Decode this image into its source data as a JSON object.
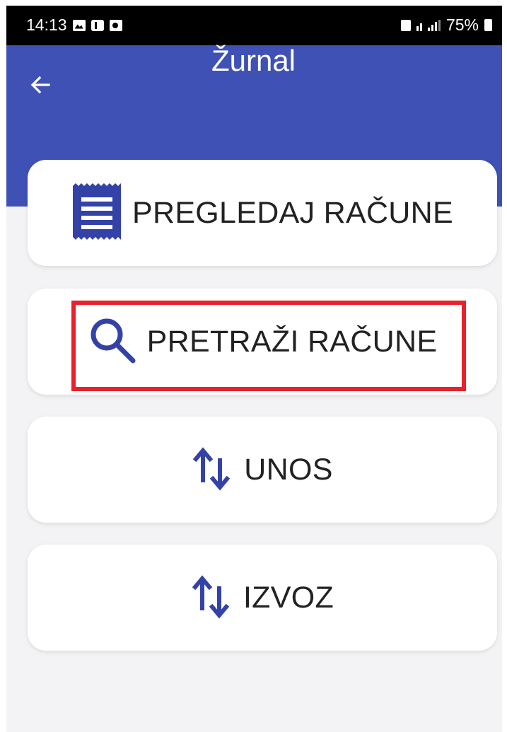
{
  "status_bar": {
    "time": "14:13",
    "battery_percent": "75%",
    "icons": [
      "gallery-icon",
      "teams-icon",
      "outlook-icon",
      "lock-icon",
      "data-icon",
      "signal-icon",
      "battery-icon"
    ]
  },
  "app_bar": {
    "title": "Žurnal",
    "back_icon": "arrow-left-icon",
    "background_color": "#3f51b5"
  },
  "menu": {
    "items": [
      {
        "label": "PREGLEDAJ RAČUNE",
        "icon": "receipt-icon"
      },
      {
        "label": "PRETRAŽI RAČUNE",
        "icon": "search-icon",
        "highlighted": true
      },
      {
        "label": "UNOS",
        "icon": "swap-vertical-icon"
      },
      {
        "label": "IZVOZ",
        "icon": "swap-vertical-icon"
      }
    ]
  },
  "colors": {
    "accent": "#3f51b5",
    "highlight_border": "#e8212b",
    "card_background": "#ffffff",
    "page_background": "#f3f3f5"
  }
}
